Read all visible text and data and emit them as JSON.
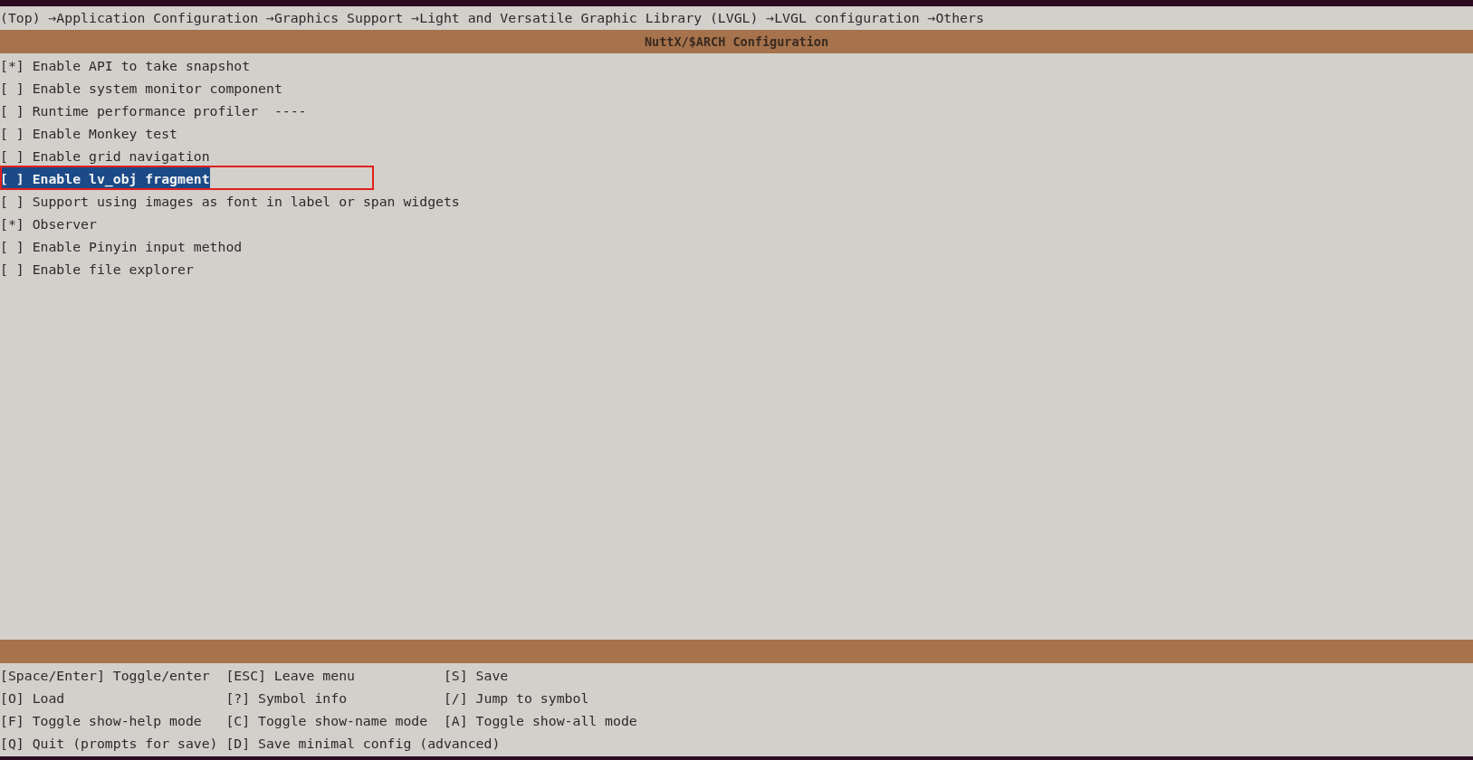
{
  "breadcrumb": "(Top) →Application Configuration →Graphics Support →Light and Versatile Graphic Library (LVGL) →LVGL configuration →Others",
  "title": "NuttX/$ARCH Configuration",
  "items": [
    {
      "box": "[*]",
      "label": "Enable API to take snapshot",
      "selected": false,
      "annotated": false
    },
    {
      "box": "[ ]",
      "label": "Enable system monitor component",
      "selected": false,
      "annotated": false
    },
    {
      "box": "[ ]",
      "label": "Runtime performance profiler  ----",
      "selected": false,
      "annotated": false
    },
    {
      "box": "[ ]",
      "label": "Enable Monkey test",
      "selected": false,
      "annotated": false
    },
    {
      "box": "[ ]",
      "label": "Enable grid navigation",
      "selected": false,
      "annotated": false
    },
    {
      "box": "[ ]",
      "label": "Enable lv_obj fragment",
      "selected": true,
      "annotated": true
    },
    {
      "box": "[ ]",
      "label": "Support using images as font in label or span widgets",
      "selected": false,
      "annotated": false
    },
    {
      "box": "[*]",
      "label": "Observer",
      "selected": false,
      "annotated": false
    },
    {
      "box": "[ ]",
      "label": "Enable Pinyin input method",
      "selected": false,
      "annotated": false
    },
    {
      "box": "[ ]",
      "label": "Enable file explorer",
      "selected": false,
      "annotated": false
    }
  ],
  "keys": [
    [
      "[Space/Enter] Toggle/enter",
      "[ESC] Leave menu",
      "[S] Save"
    ],
    [
      "[O] Load",
      "[?] Symbol info",
      "[/] Jump to symbol"
    ],
    [
      "[F] Toggle show-help mode",
      "[C] Toggle show-name mode",
      "[A] Toggle show-all mode"
    ],
    [
      "[Q] Quit (prompts for save)",
      "[D] Save minimal config (advanced)"
    ]
  ]
}
